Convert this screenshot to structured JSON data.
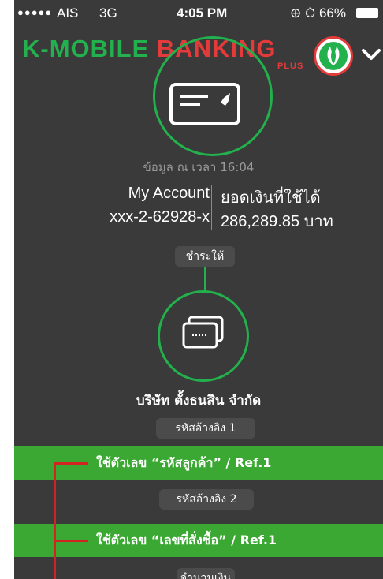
{
  "status_bar": {
    "signal_dots": "●●●●●",
    "carrier": "AIS",
    "network": "3G",
    "time": "4:05 PM",
    "battery_text": "⊕ ⏱ 66%"
  },
  "header": {
    "brand_k": "K-MOBILE ",
    "brand_b": "BANKING",
    "brand_plus": "PLUS",
    "logo_icon": "kbank-logo-icon",
    "menu_icon": "chevron-down-icon"
  },
  "account": {
    "info_time": "ข้อมูล ณ เวลา 16:04",
    "name": "My Account",
    "number": "xxx-2-62928-x",
    "balance_label": "ยอดเงินที่ใช้ได้",
    "balance_value": "286,289.85 บาท"
  },
  "payment": {
    "pay_label": "ชำระให้",
    "company": "บริษัท ตั้งธนสิน จำกัด",
    "ref1_label": "รหัสอ้างอิง 1",
    "ref1_hint": "ใช้ตัวเลข “รหัสลูกค้า” / Ref.1",
    "ref2_label": "รหัสอ้างอิง 2",
    "ref2_hint": "ใช้ตัวเลข “เลขที่สั่งซื้อ” / Ref.1",
    "ref3_label": "จำนวนเงิน"
  },
  "colors": {
    "background": "#3a3a3a",
    "accent_green": "#22b14c",
    "accent_red": "#e43a3a",
    "band_green": "#3aa832"
  }
}
